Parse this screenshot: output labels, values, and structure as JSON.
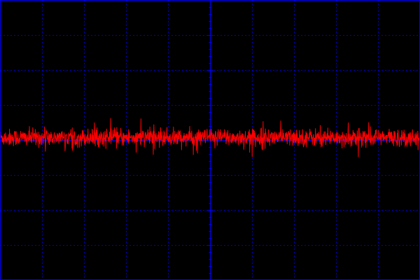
{
  "colors": {
    "background": "#000000",
    "grid": "#0000cc",
    "axis": "#0000ff",
    "trace": "#ff0000"
  },
  "chart_data": {
    "type": "line",
    "grid": true,
    "grid_style": "dotted",
    "x_divisions": 10,
    "y_divisions": 8,
    "center_axes": true,
    "center_axis_ticks": true,
    "xlim": [
      -5,
      5
    ],
    "ylim": [
      -4,
      4
    ],
    "series": [
      {
        "color": "#ff0000",
        "signal": "noise",
        "offset": 0.07,
        "typical_amplitude": 0.12,
        "peak_amplitude": 0.55,
        "points": 1500
      }
    ]
  }
}
